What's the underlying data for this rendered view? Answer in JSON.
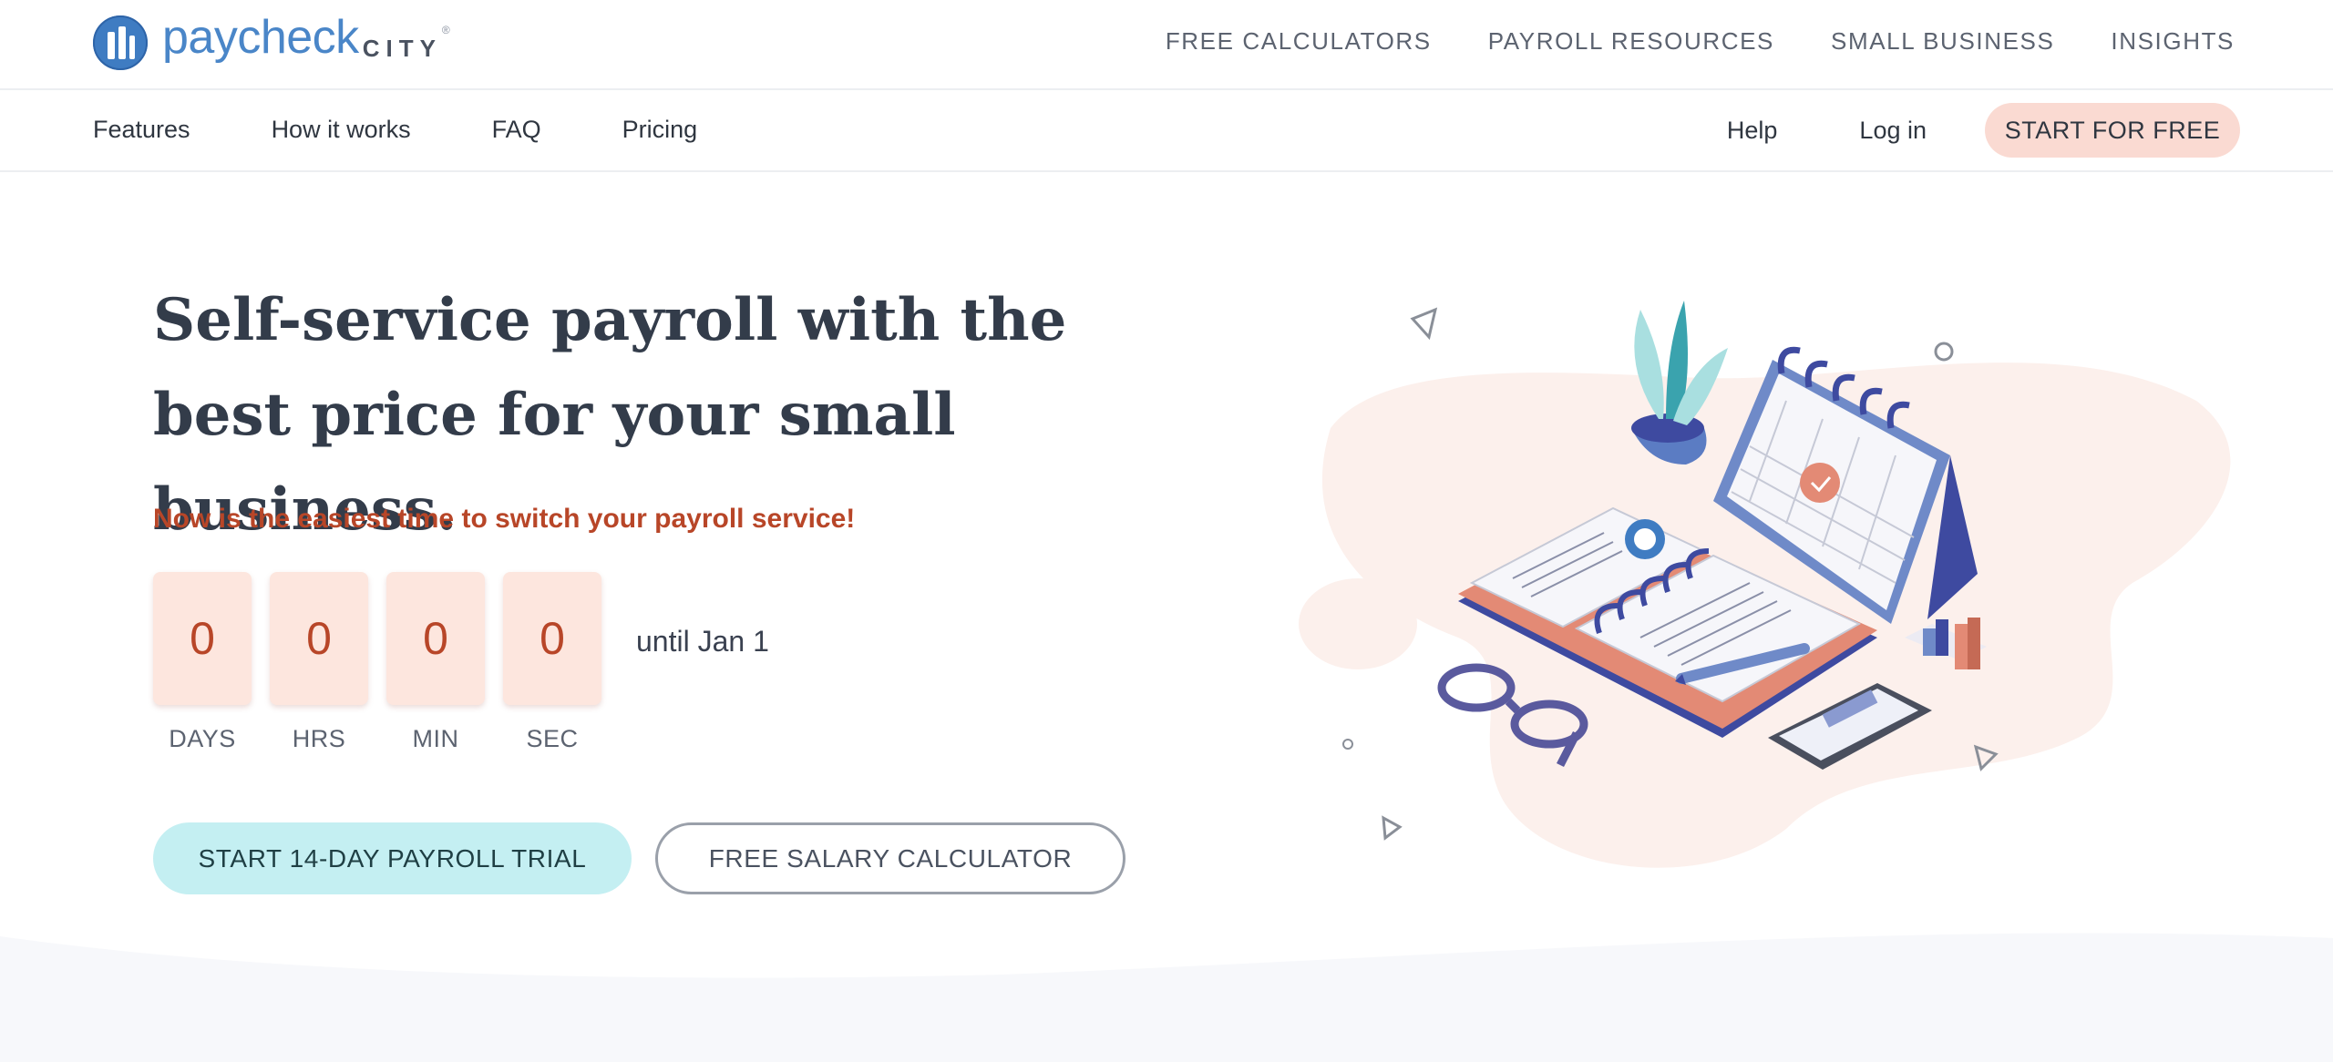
{
  "brand": {
    "name": "paycheck",
    "name_suffix": "CITY",
    "registered_mark": "®",
    "colors": {
      "brand_blue": "#4a86c8",
      "accent_orange": "#b84628",
      "cta_pink": "#fadad2",
      "trial_cyan": "#c4eff2"
    }
  },
  "top_nav": {
    "items": [
      "FREE CALCULATORS",
      "PAYROLL RESOURCES",
      "SMALL BUSINESS",
      "INSIGHTS"
    ]
  },
  "sub_nav": {
    "left": [
      "Features",
      "How it works",
      "FAQ",
      "Pricing"
    ],
    "help": "Help",
    "login": "Log in",
    "cta": "START FOR FREE"
  },
  "hero": {
    "title": "Self-service payroll with the best price for your small business.",
    "subtitle": "Now is the easiest time to switch your payroll service!",
    "countdown": {
      "days": "0",
      "hours": "0",
      "minutes": "0",
      "seconds": "0",
      "labels": {
        "days": "DAYS",
        "hours": "HRS",
        "minutes": "MIN",
        "seconds": "SEC"
      },
      "until": "until Jan 1"
    },
    "primary_button": "START 14-DAY PAYROLL TRIAL",
    "secondary_button": "FREE SALARY CALCULATOR"
  },
  "illustration": {
    "icons": [
      "plant-icon",
      "calendar-icon",
      "notebook-icon",
      "glasses-icon",
      "phone-icon",
      "bar-chart-icon",
      "pen-icon"
    ]
  }
}
